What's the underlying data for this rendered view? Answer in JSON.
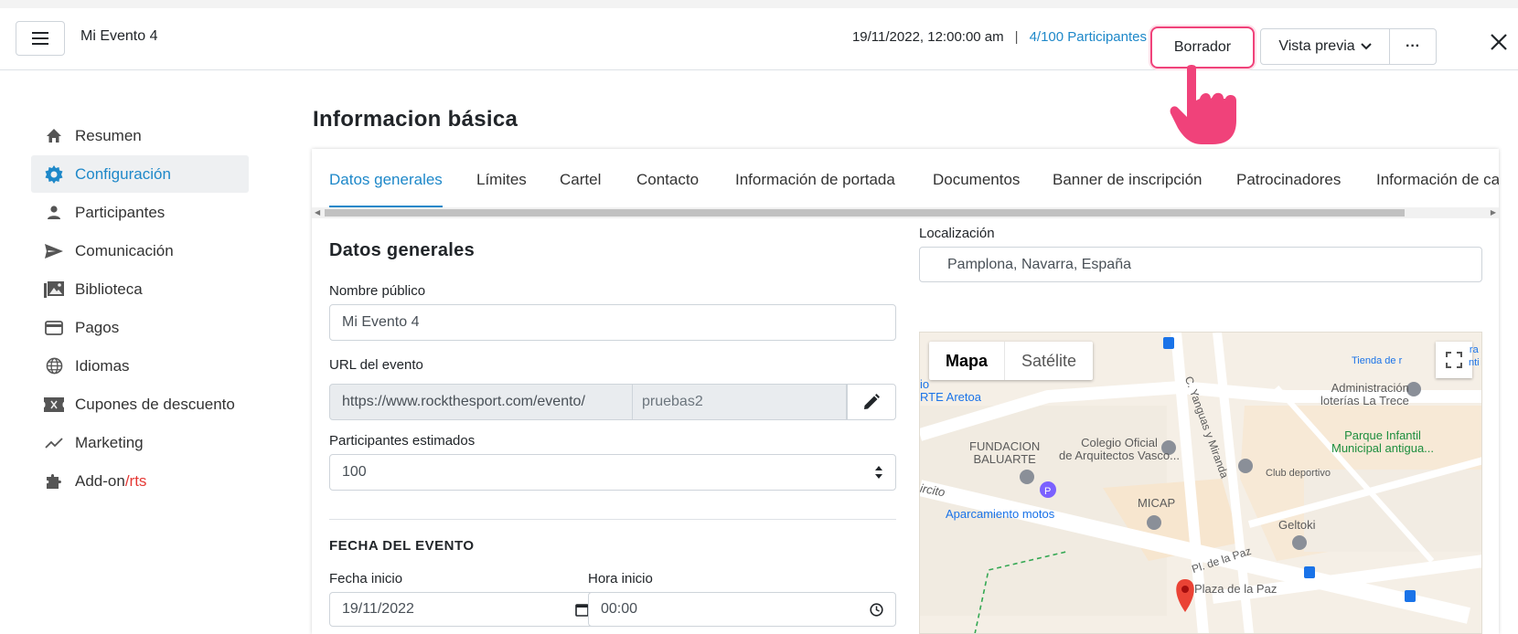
{
  "header": {
    "event_title": "Mi Evento 4",
    "datetime": "19/11/2022, 12:00:00 am",
    "separator": "|",
    "participants_count": "4/100",
    "participants_link": "Participantes",
    "draft_label": "Borrador",
    "preview_label": "Vista previa",
    "more_label": "···"
  },
  "sidebar": {
    "items": [
      {
        "label": "Resumen",
        "icon": "home-icon"
      },
      {
        "label": "Configuración",
        "icon": "gear-icon",
        "active": true
      },
      {
        "label": "Participantes",
        "icon": "user-icon"
      },
      {
        "label": "Comunicación",
        "icon": "send-icon"
      },
      {
        "label": "Biblioteca",
        "icon": "image-library-icon"
      },
      {
        "label": "Pagos",
        "icon": "credit-card-icon"
      },
      {
        "label": "Idiomas",
        "icon": "globe-icon"
      },
      {
        "label": "Cupones de descuento",
        "icon": "ticket-icon"
      },
      {
        "label": "Marketing",
        "icon": "trend-icon"
      },
      {
        "label": "Add-on",
        "label_suffix": "/rts",
        "icon": "puzzle-icon"
      }
    ]
  },
  "main": {
    "page_title": "Informacion básica",
    "tabs": [
      {
        "label": "Datos generales",
        "active": true
      },
      {
        "label": "Límites"
      },
      {
        "label": "Cartel"
      },
      {
        "label": "Contacto"
      },
      {
        "label": "Información de portada"
      },
      {
        "label": "Documentos"
      },
      {
        "label": "Banner de inscripción"
      },
      {
        "label": "Patrocinadores"
      },
      {
        "label": "Información de ca"
      }
    ],
    "form": {
      "section_title": "Datos generales",
      "public_name_label": "Nombre público",
      "public_name_value": "Mi Evento 4",
      "url_label": "URL del evento",
      "url_prefix": "https://www.rockthesport.com/evento/",
      "url_slug": "pruebas2",
      "estimated_label": "Participantes estimados",
      "estimated_value": "100",
      "event_date_section": "FECHA DEL EVENTO",
      "start_date_label": "Fecha inicio",
      "start_date_value": "19/11/2022",
      "start_time_label": "Hora inicio",
      "start_time_value": "00:00",
      "location_label": "Localización",
      "location_value": "Pamplona, Navarra, España"
    },
    "map": {
      "type_map": "Mapa",
      "type_satellite": "Satélite",
      "labels": {
        "aretoa": "io\nRTE Aretoa",
        "tienda": "Tienda de r",
        "ra": "ra\nnti",
        "admin": "Administración\nloterías La Trece",
        "street_yanguas": "C. Yanguas y Miranda",
        "fundacion": "FUNDACION\nBALUARTE",
        "colegio": "Colegio Oficial\nde Arquitectos Vasco...",
        "parque": "Parque Infantil\nMunicipal antigua...",
        "club": "Club deportivo",
        "ircito": "ircito",
        "micap": "MICAP",
        "aparcamiento": "Aparcamiento motos",
        "geltoki": "Geltoki",
        "pl_paz": "Pl. de la Paz",
        "plaza_paz": "Plaza de la Paz"
      }
    }
  },
  "colors": {
    "accent": "#1e88c9",
    "draft_border": "#f0427a",
    "hand": "#f0427a",
    "addon_suffix": "#e53935"
  }
}
